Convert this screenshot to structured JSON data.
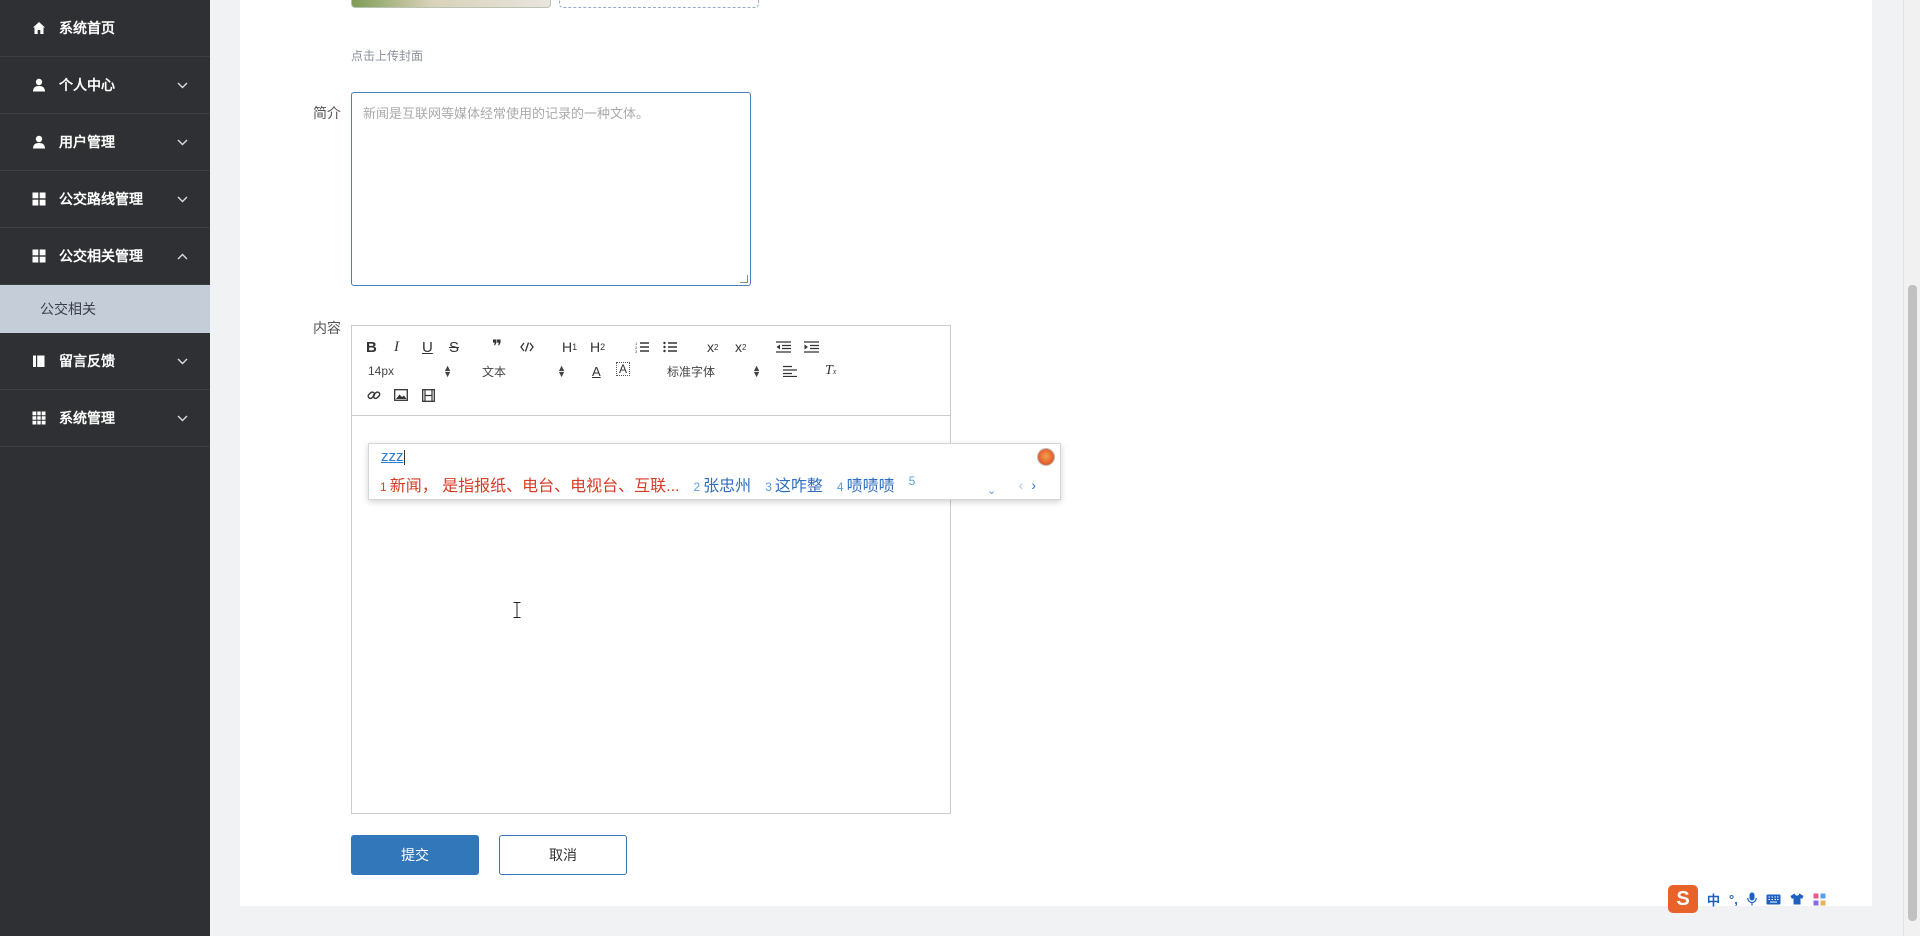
{
  "sidebar": {
    "items": [
      {
        "label": "系统首页",
        "icon": "home-icon",
        "has_chevron": false
      },
      {
        "label": "个人中心",
        "icon": "user-icon",
        "has_chevron": true
      },
      {
        "label": "用户管理",
        "icon": "user-icon",
        "has_chevron": true
      },
      {
        "label": "公交路线管理",
        "icon": "grid-icon",
        "has_chevron": true
      },
      {
        "label": "公交相关管理",
        "icon": "grid-icon",
        "has_chevron": true,
        "expanded": true
      },
      {
        "label": "留言反馈",
        "icon": "book-icon",
        "has_chevron": true
      },
      {
        "label": "系统管理",
        "icon": "table-icon",
        "has_chevron": true
      }
    ],
    "active_sub": "公交相关"
  },
  "form": {
    "cover_hint": "点击上传封面",
    "intro_label": "简介",
    "intro_placeholder": "新闻是互联网等媒体经常使用的记录的一种文体。",
    "content_label": "内容",
    "submit_label": "提交",
    "cancel_label": "取消"
  },
  "editor": {
    "font_size": "14px",
    "block_format": "文本",
    "font_family": "标准字体",
    "toolbar_icons": [
      "bold-icon",
      "italic-icon",
      "underline-icon",
      "strike-icon",
      "blockquote-icon",
      "code-icon",
      "h1-icon",
      "h2-icon",
      "ordered-list-icon",
      "bullet-list-icon",
      "subscript-icon",
      "superscript-icon",
      "indent-decrease-icon",
      "indent-increase-icon",
      "font-color-icon",
      "background-color-icon",
      "align-icon",
      "clear-format-icon",
      "link-icon",
      "image-icon",
      "video-icon"
    ]
  },
  "ime": {
    "input": "zzz",
    "candidates": [
      {
        "num": "1",
        "text": "新闻， 是指报纸、电台、电视台、互联..."
      },
      {
        "num": "2",
        "text": "张忠州"
      },
      {
        "num": "3",
        "text": "这咋整"
      },
      {
        "num": "4",
        "text": "啧啧啧"
      },
      {
        "num": "5",
        "text": ""
      }
    ],
    "status_bar": {
      "mode": "中",
      "punct": "°,"
    }
  },
  "colors": {
    "sidebar_bg": "#2f3033",
    "sub_active_bg": "#c5cdd9",
    "primary": "#3377bb",
    "ime_first": "#d93b24",
    "ime_text": "#2e6fbf"
  }
}
